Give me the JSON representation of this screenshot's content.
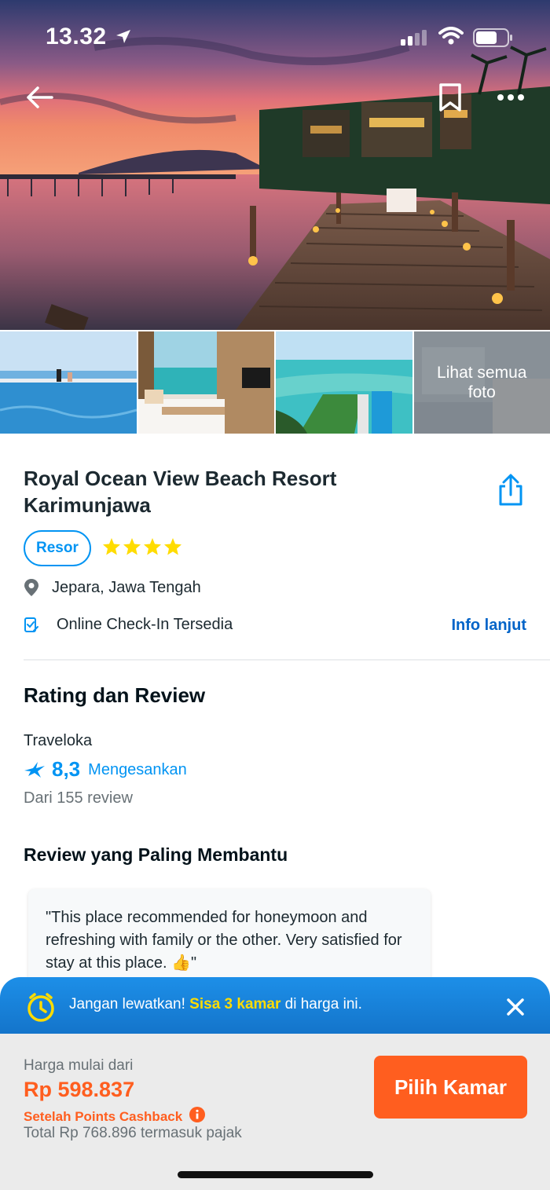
{
  "status": {
    "time": "13.32"
  },
  "thumbs": {
    "more_label": "Lihat semua foto"
  },
  "hotel": {
    "name": "Royal Ocean View Beach Resort Karimunjawa",
    "type_badge": "Resor",
    "stars": 4,
    "location": "Jepara, Jawa Tengah",
    "checkin_text": "Online Check-In Tersedia",
    "info_link": "Info lanjut"
  },
  "rating": {
    "heading": "Rating dan Review",
    "source": "Traveloka",
    "score": "8,3",
    "score_word": "Mengesankan",
    "review_count": "Dari 155 review"
  },
  "reviews": {
    "heading": "Review yang Paling Membantu",
    "top_review": "\"This place recommended for honeymoon and refreshing with family or the other. Very satisfied for stay at this place. 👍\""
  },
  "urgency": {
    "prefix": "Jangan lewatkan! ",
    "highlight": "Sisa 3 kamar",
    "suffix": " di harga ini."
  },
  "booking": {
    "price_label": "Harga mulai dari",
    "price": "Rp 598.837",
    "cashback_label": "Setelah Points Cashback",
    "total": "Total Rp 768.896 termasuk pajak",
    "cta_label": "Pilih Kamar"
  },
  "colors": {
    "primary_blue": "#0194f3",
    "link_blue": "#0264c8",
    "orange": "#ff5e1f",
    "star_yellow": "#ffdc00"
  }
}
